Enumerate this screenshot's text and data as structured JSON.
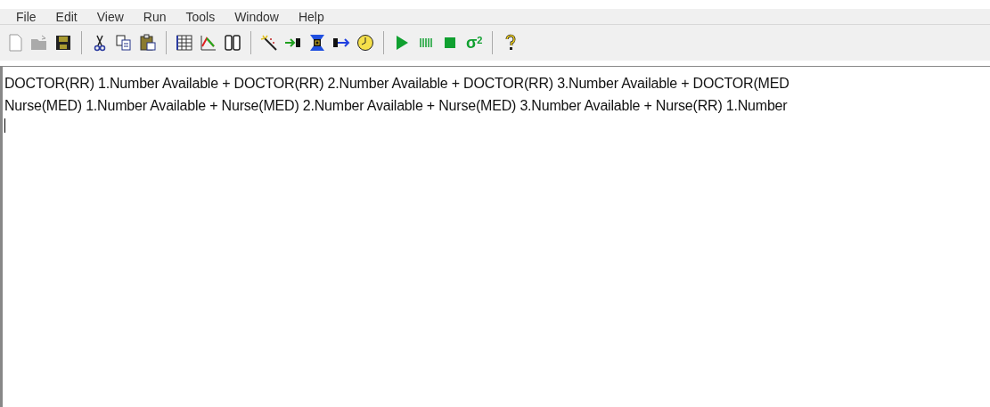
{
  "menu": [
    "File",
    "Edit",
    "View",
    "Run",
    "Tools",
    "Window",
    "Help"
  ],
  "toolbar": [
    {
      "kind": "new"
    },
    {
      "kind": "open",
      "disabled": true
    },
    {
      "kind": "save"
    },
    {
      "kind": "sep"
    },
    {
      "kind": "cut"
    },
    {
      "kind": "copy"
    },
    {
      "kind": "paste"
    },
    {
      "kind": "sep"
    },
    {
      "kind": "table"
    },
    {
      "kind": "chart"
    },
    {
      "kind": "columns"
    },
    {
      "kind": "sep"
    },
    {
      "kind": "wand"
    },
    {
      "kind": "stepin"
    },
    {
      "kind": "hourglass"
    },
    {
      "kind": "stepout"
    },
    {
      "kind": "clock"
    },
    {
      "kind": "sep"
    },
    {
      "kind": "play"
    },
    {
      "kind": "bars"
    },
    {
      "kind": "stop"
    },
    {
      "kind": "sigma",
      "label": "σ",
      "sup": "2"
    },
    {
      "kind": "sep"
    },
    {
      "kind": "help"
    }
  ],
  "editor": {
    "lines": [
      "DOCTOR(RR) 1.Number Available + DOCTOR(RR) 2.Number Available + DOCTOR(RR) 3.Number Available + DOCTOR(MED",
      "Nurse(MED) 1.Number Available + Nurse(MED) 2.Number Available + Nurse(MED) 3.Number Available + Nurse(RR) 1.Number"
    ]
  }
}
